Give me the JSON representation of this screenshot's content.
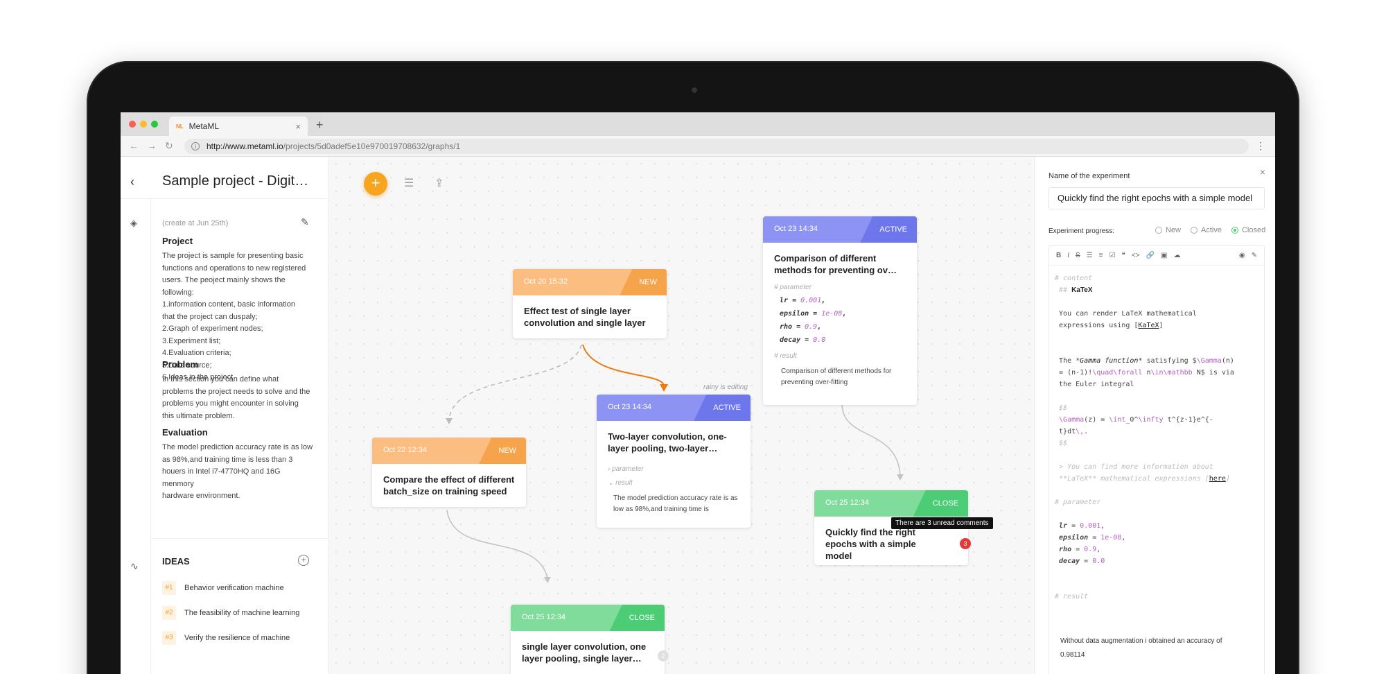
{
  "browser": {
    "tab_title": "MetaML",
    "tab_favicon": "NL",
    "new_tab": "+",
    "url_host": "http://www.metaml.io",
    "url_path": "/projects/5d0adef5e10e970019708632/graphs/1",
    "menu": "⋮"
  },
  "sidebar": {
    "back": "‹",
    "title": "Sample project - Digit…",
    "created": "(create at Jun 25th)",
    "project": {
      "heading": "Project",
      "body": "The project is sample for presenting basic\nfunctions and operations to new registered\nusers. The peoject mainly shows the\nfollowing:\n1.information content, basic information\nthat the project can duspaly;\n2.Graph of experiment nodes;\n3.Experiment list;\n4.Evaluation criteria;\n5.Data source;\n6.Ideas in the project."
    },
    "problem": {
      "heading": "Problem",
      "body": "In this section you can define what\nproblems the project needs to solve and the\nproblems you might encounter in solving\nthis ultimate problem."
    },
    "evaluation": {
      "heading": "Evaluation",
      "body": "The model prediction accuracy rate is as low\nas 98%,and training time is less than 3\nhouers in Intel i7-4770HQ and 16G menmory\nhardware environment."
    },
    "ideas_title": "IDEAS",
    "ideas": [
      {
        "num": "#1",
        "label": "Behavior verification machine"
      },
      {
        "num": "#2",
        "label": "The feasibility of machine learning"
      },
      {
        "num": "#3",
        "label": "Verify the resilience of machine"
      }
    ]
  },
  "canvas": {
    "add": "+",
    "editing_note": "rainy is editing",
    "nodes": [
      {
        "date": "Oct 20 15:32",
        "status": "NEW",
        "title": "Effect test of single layer convolution and single layer"
      },
      {
        "date": "Oct 22 12:34",
        "status": "NEW",
        "title": "Compare the effect of different batch_size on training speed"
      },
      {
        "date": "Oct 23 14:34",
        "status": "ACTIVE",
        "title": "Two-layer convolution, one-layer pooling, two-layer…",
        "param_label": "› parameter",
        "result_label": "⌄ result",
        "result": "The model prediction accuracy rate is as low as 98%,and training time is"
      },
      {
        "date": "Oct 23 14:34",
        "status": "ACTIVE",
        "title": "Comparison of different methods for preventing ov…",
        "param_label": "# parameter",
        "params": [
          [
            "lr",
            "0.001"
          ],
          [
            "epsilon",
            "1e-08"
          ],
          [
            "rho",
            "0.9"
          ],
          [
            "decay",
            "0.0"
          ]
        ],
        "result_label": "# result",
        "result": "Comparison of different methods for preventing over-fitting"
      },
      {
        "date": "Oct 25 12:34",
        "status": "CLOSE",
        "title": "Quickly find the right epochs with a simple model",
        "badge": "3",
        "tooltip": "There are 3 unread comments"
      },
      {
        "date": "Oct 25 12:34",
        "status": "CLOSE",
        "title": "single layer convolution, one layer pooling, single layer…",
        "badge": "2"
      }
    ]
  },
  "panel": {
    "name_label": "Name of the experiment",
    "name_value": "Quickly find the right epochs with a simple model",
    "progress_label": "Experiment progress:",
    "progress_options": [
      "New",
      "Active",
      "Closed"
    ],
    "progress_selected": "Closed",
    "toolbar": [
      "B",
      "I",
      "S",
      "☰",
      "≡",
      "☑",
      "❝",
      "<>",
      "🔗",
      "▣",
      "☁"
    ],
    "toolbar_right": [
      "◉",
      "✎"
    ],
    "content_label": "# content",
    "katex_heading": "KaTeX",
    "katex_hashes": "##",
    "line1a": "You can render LaTeX mathematical",
    "line1b": "expressions using [",
    "katex_link": "KaTeX",
    "line1c": "]",
    "gamma1": "The *",
    "gamma_it": "Gamma function",
    "gamma2": "* satisfying $",
    "gamma_cmd": "\\Gamma",
    "gamma3": "(n)",
    "gamma4": "= (n-1)!",
    "gamma_cmd2": "\\quad\\forall",
    "gamma5": " n",
    "gamma_cmd3": "\\in\\mathbb",
    "gamma6": " N$ is via",
    "gamma7": "the Euler integral",
    "dollars": "$$",
    "euler_cmd": "\\Gamma",
    "euler1": "(z) = ",
    "euler_cmd2": "\\int",
    "euler2": "_0^",
    "euler_cmd3": "\\infty",
    "euler3": " t^{z-1}e^{-",
    "euler4": "t}dt",
    "euler_cmd4": "\\,",
    "euler5": ".",
    "quote1": "> You can find more information about",
    "quote2a": "**LaTeX** mathematical expressions [",
    "quote_link": "here",
    "quote2b": "]",
    "param_label": "# parameter",
    "params": [
      [
        "lr",
        "0.001"
      ],
      [
        "epsilon",
        "1e-08"
      ],
      [
        "rho",
        "0.9"
      ],
      [
        "decay",
        "0.0"
      ]
    ],
    "result_label": "# result",
    "result1": "Without data augmentation i obtained an accuracy of",
    "result2": "0.98114",
    "close": "×"
  },
  "colors": {
    "new": "#f5a44c",
    "active": "#6e76ec",
    "close": "#4ccc75",
    "accent": "#f7a41e"
  }
}
